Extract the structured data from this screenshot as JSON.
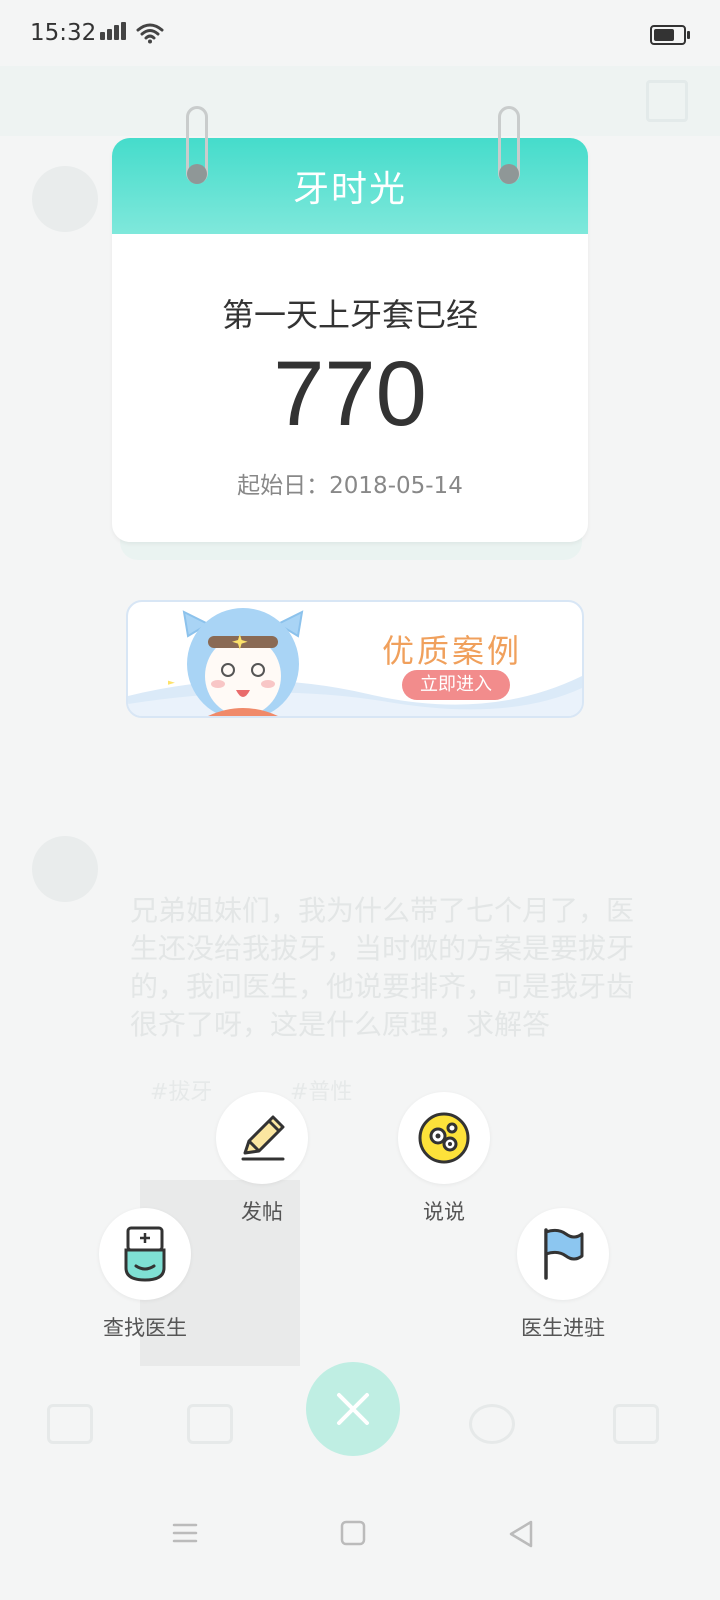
{
  "status_bar": {
    "time": "15:32"
  },
  "calendar_card": {
    "title": "牙时光",
    "subtitle": "第一天上牙套已经",
    "days": "770",
    "start_label": "起始日：",
    "start_date": "2018-05-14"
  },
  "banner": {
    "title": "优质案例",
    "button_label": "立即进入"
  },
  "actions": {
    "post": {
      "label": "发帖",
      "icon": "pencil-icon"
    },
    "talk": {
      "label": "说说",
      "icon": "emoji-face-icon"
    },
    "find_doctor": {
      "label": "查找医生",
      "icon": "doctor-icon"
    },
    "doctor_join": {
      "label": "医生进驻",
      "icon": "flag-icon"
    }
  },
  "close_button": {
    "icon": "close-icon"
  },
  "background_feed": {
    "post_text": "兄弟姐妹们，我为什么带了七个月了，医生还没给我拔牙，当时做的方案是要拔牙的，我问医生，他说要排齐，可是我牙齿很齐了呀，这是什么原理，求解答",
    "tags": [
      "#拔牙",
      "#普性"
    ]
  },
  "colors": {
    "card_header_top": "#45dccb",
    "card_header_bottom": "#7fe8db",
    "banner_title": "#f0a05c",
    "banner_button": "#f28c8c",
    "close_button": "#bfeee3"
  }
}
